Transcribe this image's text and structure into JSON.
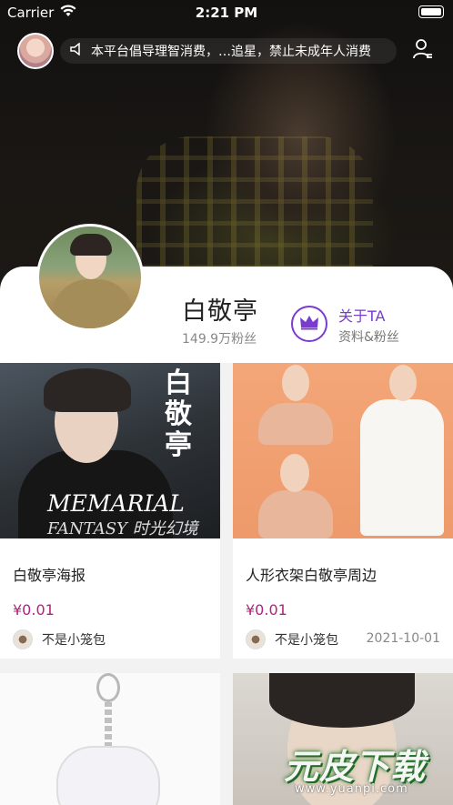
{
  "status_bar": {
    "carrier": "Carrier",
    "time": "2:21 PM"
  },
  "header": {
    "notice": "本平台倡导理智消费，…追星，禁止未成年人消费",
    "icons": {
      "notice": "speaker-icon",
      "menu": "user-menu-icon"
    }
  },
  "profile": {
    "name": "白敬亭",
    "fans": "149.9万粉丝",
    "about_title": "关于TA",
    "about_sub": "资料&粉丝",
    "accent_color": "#7a3bd1"
  },
  "products": [
    {
      "title": "白敬亭海报",
      "price": "¥0.01",
      "seller": "不是小笼包",
      "date": "",
      "image_text": {
        "cn": "白敬亭",
        "en1": "MEMARIAL",
        "en2": "FANTASY 时光幻境"
      }
    },
    {
      "title": "人形衣架白敬亭周边",
      "price": "¥0.01",
      "seller": "不是小笼包",
      "date": "2021-10-01"
    },
    {
      "title": "",
      "price": "",
      "seller": "",
      "date": ""
    },
    {
      "title": "",
      "price": "",
      "seller": "",
      "date": ""
    }
  ],
  "watermark": {
    "brand": "元皮下载",
    "url": "www.yuanpi.com"
  },
  "colors": {
    "price": "#b0237e",
    "accent": "#7a3bd1"
  }
}
